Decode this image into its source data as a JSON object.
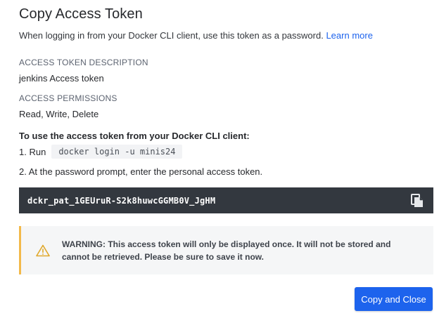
{
  "dialog": {
    "title": "Copy Access Token",
    "intro_text": "When logging in from your Docker CLI client, use this token as a password.",
    "learn_more_label": "Learn more",
    "description_label": "ACCESS TOKEN DESCRIPTION",
    "description_value": "jenkins Access token",
    "permissions_label": "ACCESS PERMISSIONS",
    "permissions_value": "Read, Write, Delete",
    "instructions_heading": "To use the access token from your Docker CLI client:",
    "step1_prefix": "1. Run",
    "step1_command": "docker login -u minis24",
    "step2_text": "2. At the password prompt, enter the personal access token.",
    "token": "dckr_pat_1GEUruR-S2k8huwcGGMB0V_JgHM",
    "warning_text": "WARNING: This access token will only be displayed once. It will not be stored and cannot be retrieved. Please be sure to save it now.",
    "copy_close_label": "Copy and Close"
  },
  "icons": {
    "copy": "copy-icon",
    "warning": "warning-icon"
  },
  "colors": {
    "accent": "#1d63ed",
    "token_background": "#33383f",
    "warning_border": "#f3b94a",
    "warning_background": "#f5f6f7"
  }
}
